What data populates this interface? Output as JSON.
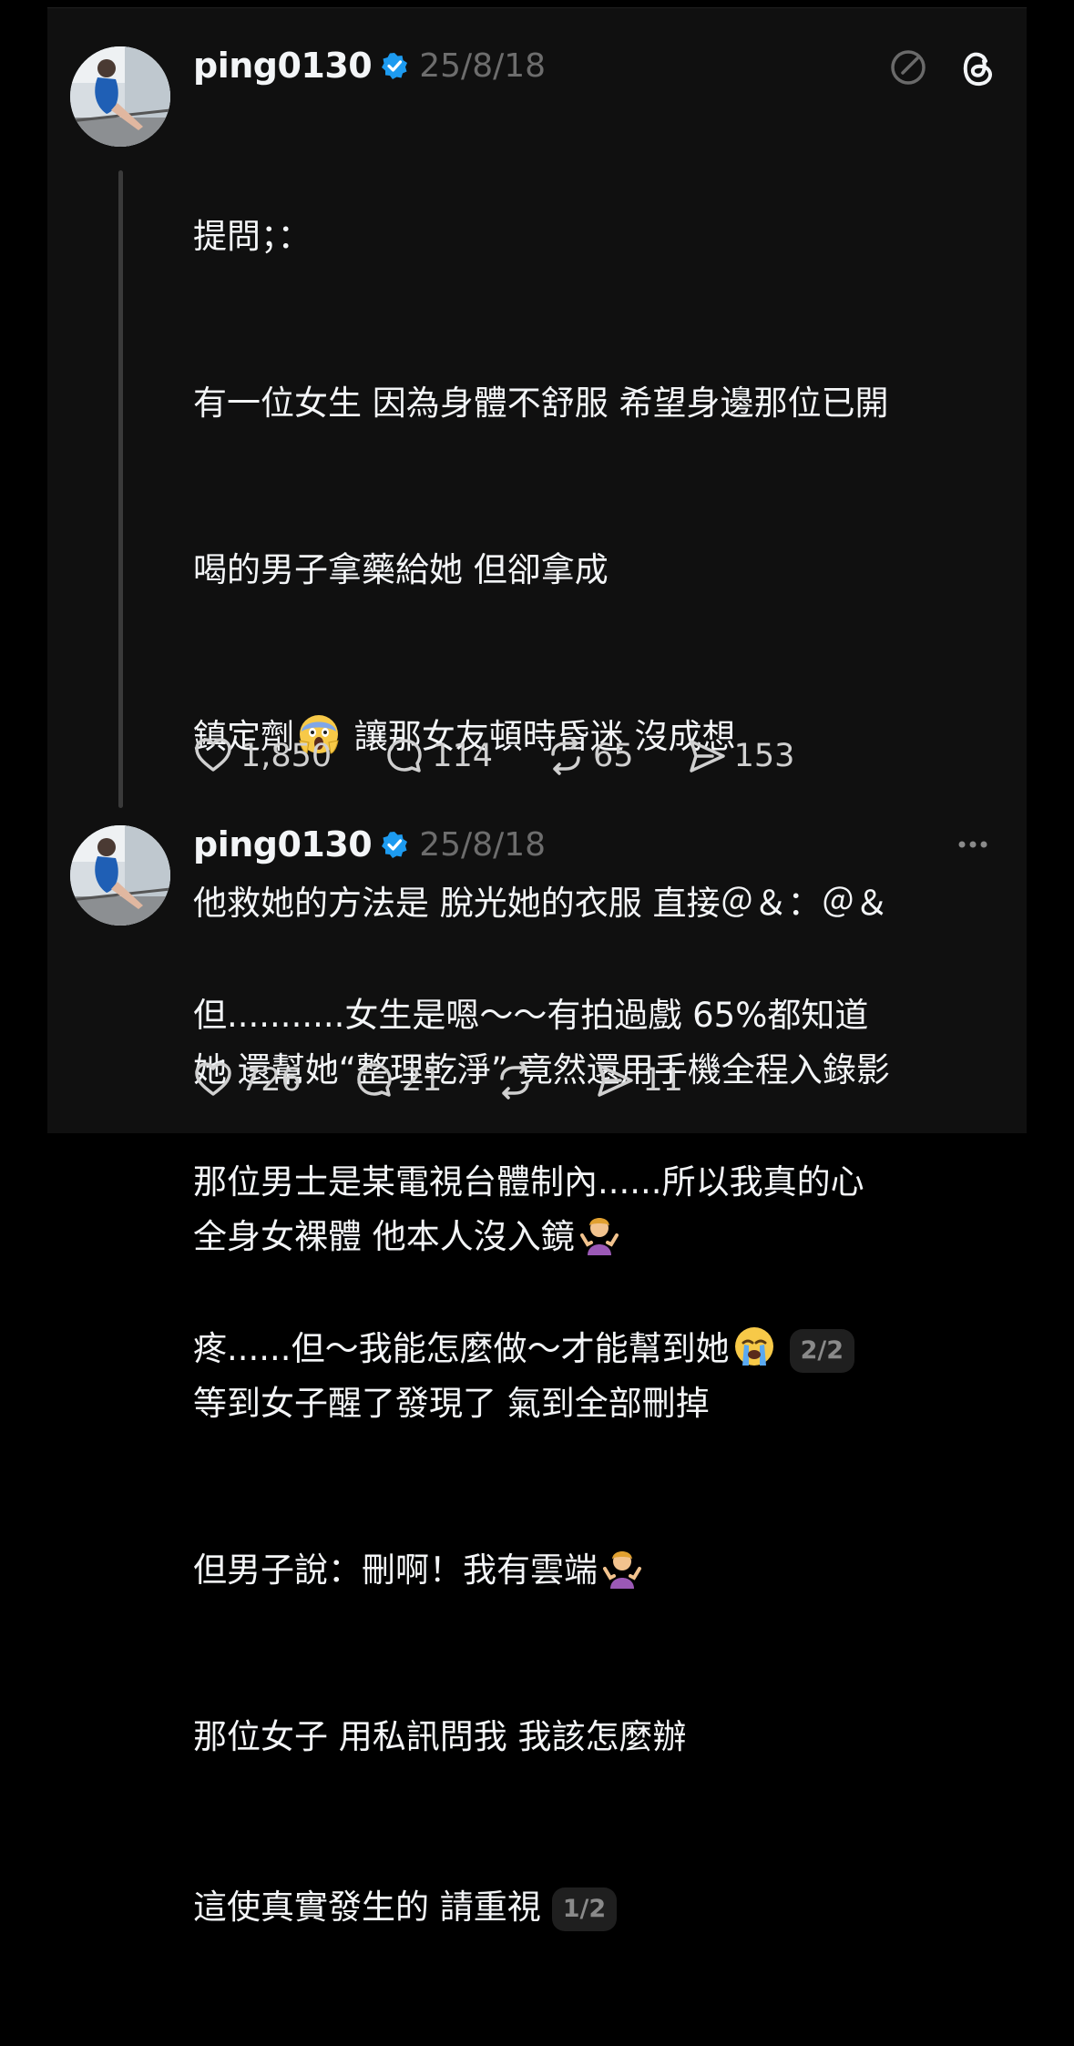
{
  "posts": [
    {
      "username": "ping0130",
      "date": "25/8/18",
      "lines": [
        "提問；：",
        "有一位女生 因為身體不舒服 希望身邊那位已開",
        "喝的男子拿藥給她 但卻拿成",
        "鎮定劑",
        " 讓那女友頓時昏迷 沒成想",
        "他救她的方法是 脫光她的衣服 直接＠＆：＠＆",
        "她 還幫她“整理乾淨” 竟然還用手機全程入錄影",
        "全身女裸體 他本人沒入鏡",
        "等到女子醒了發現了 氣到全部刪掉",
        "但男子說：刪啊！我有雲端",
        "那位女子 用私訊問我 我該怎麼辦",
        "這使真實發生的 請重視"
      ],
      "page": "1/2",
      "likes": "1,850",
      "replies": "114",
      "reposts": "65",
      "shares": "153"
    },
    {
      "username": "ping0130",
      "date": "25/8/18",
      "lines": [
        "但...........女生是嗯～～有拍過戲 65%都知道",
        "那位男士是某電視台體制內......所以我真的心",
        "疼......但～我能怎麼做～才能幫到她"
      ],
      "page": "2/2",
      "likes": "726",
      "replies": "21",
      "reposts": "",
      "shares": "11"
    }
  ],
  "colors": {
    "background": "#101010",
    "text": "#f3f5f7",
    "muted": "#6d6d6d",
    "verified": "#1d9bf0"
  },
  "icons": [
    "edit-icon",
    "threads-logo-icon",
    "more-icon",
    "heart-icon",
    "reply-icon",
    "repost-icon",
    "share-icon",
    "verified-badge-icon"
  ]
}
